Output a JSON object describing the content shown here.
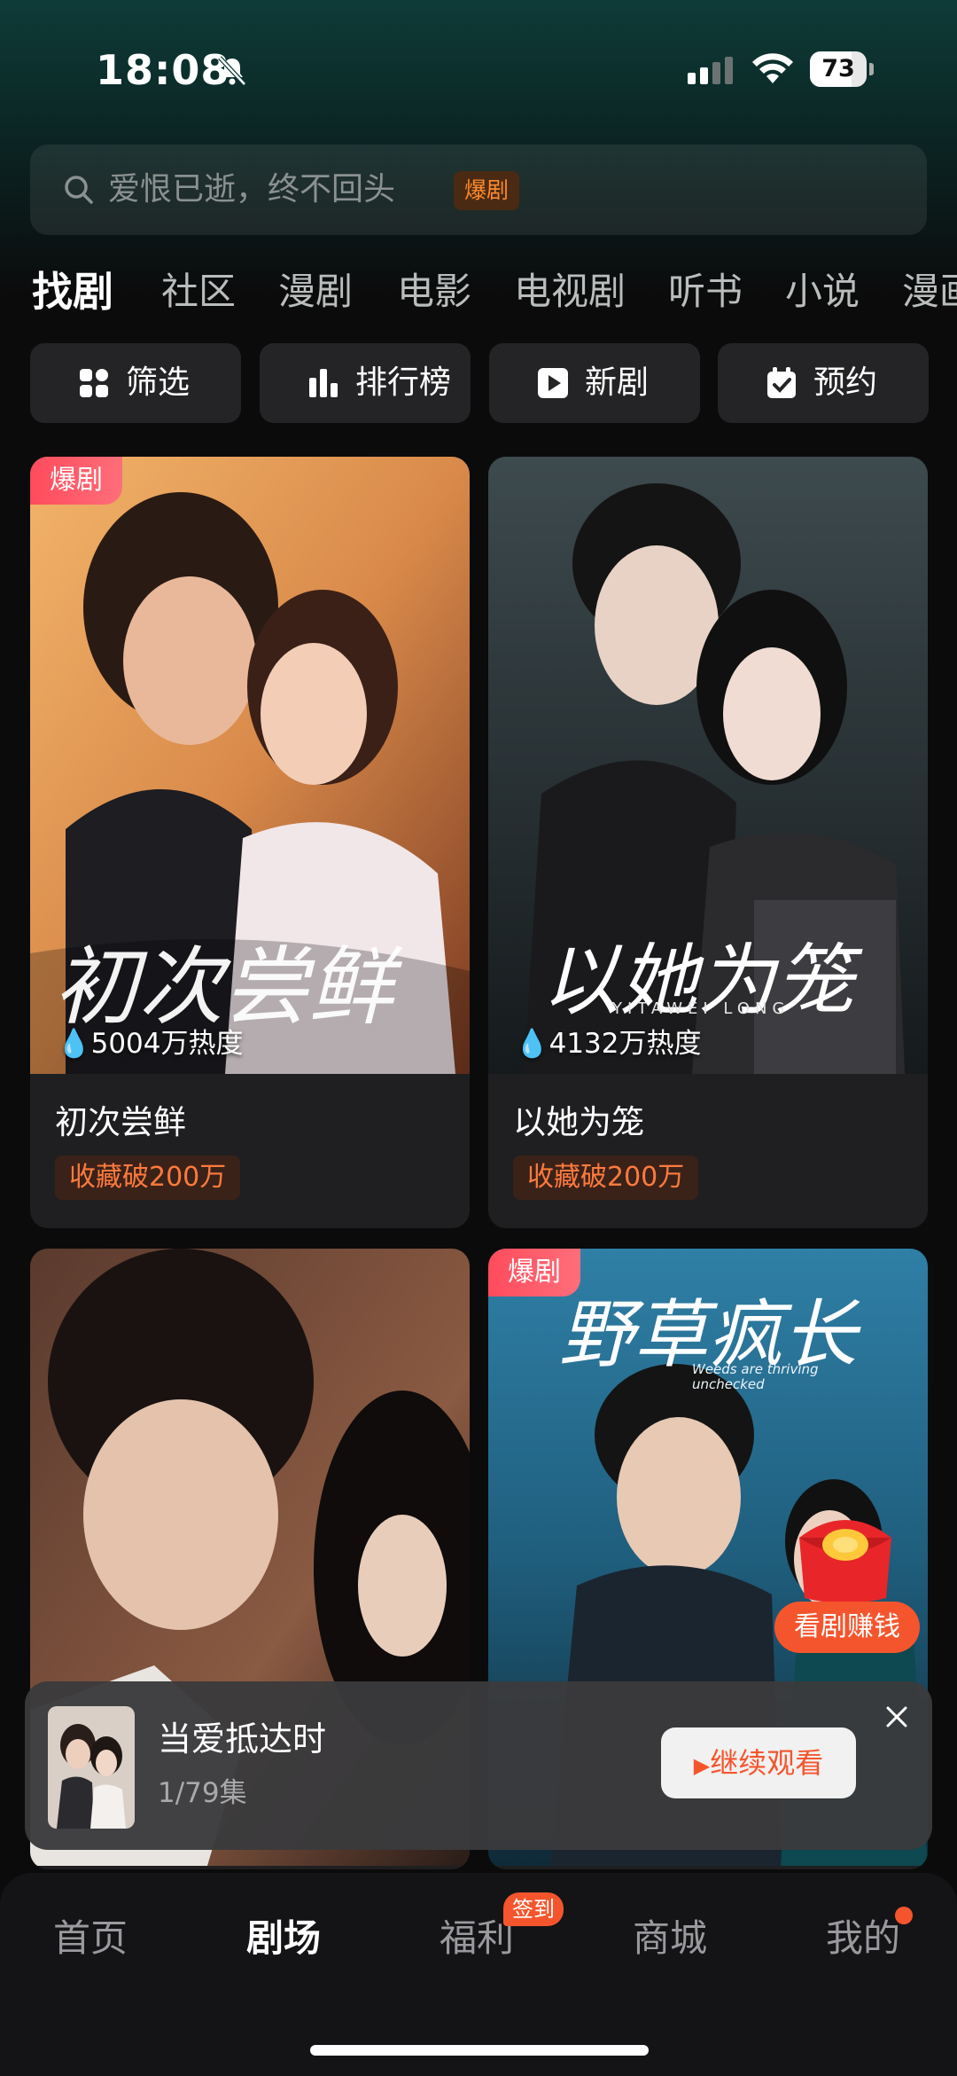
{
  "status_bar": {
    "time": "18:08",
    "battery": "73",
    "battery_level_percent": 73,
    "icons": [
      "bell-muted-icon",
      "signal-icon",
      "wifi-icon",
      "battery-icon"
    ]
  },
  "search": {
    "placeholder": "爱恨已逝，终不回头",
    "tag": "爆剧",
    "icon": "search-icon"
  },
  "tabs": [
    "找剧",
    "社区",
    "漫剧",
    "电影",
    "电视剧",
    "听书",
    "小说",
    "漫画"
  ],
  "active_tab": "找剧",
  "quick_buttons": [
    {
      "label": "筛选",
      "icon": "grid-icon"
    },
    {
      "label": "排行榜",
      "icon": "bar-chart-icon"
    },
    {
      "label": "新剧",
      "icon": "play-icon"
    },
    {
      "label": "预约",
      "icon": "calendar-check-icon"
    }
  ],
  "cards": [
    {
      "title": "初次尝鲜",
      "badge": "爆剧",
      "heat": "5004万热度",
      "tag": "收藏破200万",
      "poster_text": "初次尝鲜"
    },
    {
      "title": "以她为笼",
      "badge": "",
      "heat": "4132万热度",
      "tag": "收藏破200万",
      "poster_text": "以她为笼",
      "poster_subtext": "YITAWEI LONG"
    },
    {
      "title": "",
      "badge": "",
      "heat": "",
      "tag": ""
    },
    {
      "title": "",
      "badge": "爆剧",
      "heat": "",
      "tag": "",
      "poster_text": "野草疯长",
      "poster_subtext": "Weeds are thriving unchecked"
    }
  ],
  "promo": {
    "earn_label": "看剧赚钱"
  },
  "continue_watching": {
    "title": "当爱抵达时",
    "episode": "1/79集",
    "button": "继续观看"
  },
  "bottom_nav": [
    {
      "label": "首页"
    },
    {
      "label": "剧场"
    },
    {
      "label": "福利",
      "badge": "签到"
    },
    {
      "label": "商城"
    },
    {
      "label": "我的"
    }
  ],
  "colors": {
    "accent": "#f5552d",
    "hot_badge": "#ff4b5c",
    "background": "#0b0b0c",
    "header_teal": "#0e3b38"
  }
}
